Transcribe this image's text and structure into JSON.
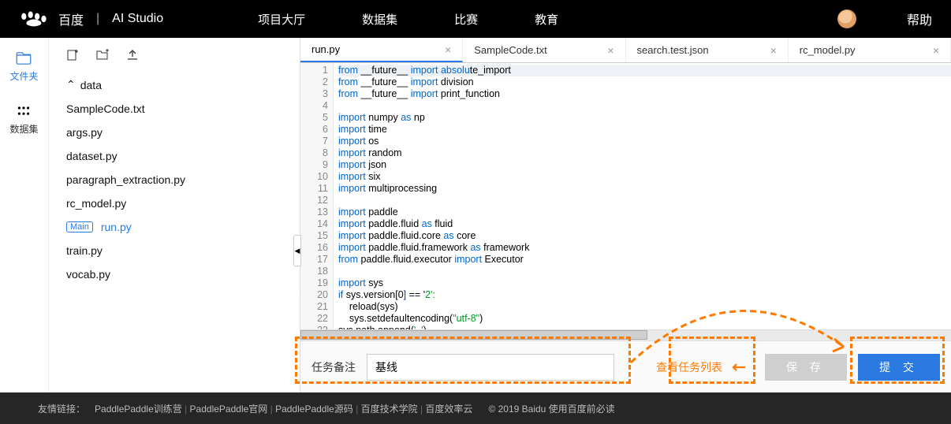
{
  "header": {
    "brand_left": "百度",
    "brand_right": "AI Studio",
    "nav": [
      "项目大厅",
      "数据集",
      "比赛",
      "教育"
    ],
    "help": "帮助"
  },
  "siderail": {
    "files_label": "文件夹",
    "dataset_label": "数据集"
  },
  "filetree": {
    "folder": "data",
    "files": [
      "SampleCode.txt",
      "args.py",
      "dataset.py",
      "paragraph_extraction.py",
      "rc_model.py",
      "run.py",
      "train.py",
      "vocab.py"
    ],
    "main_tag": "Main",
    "selected": "run.py"
  },
  "tabs": [
    {
      "name": "run.py",
      "active": true
    },
    {
      "name": "SampleCode.txt",
      "active": false
    },
    {
      "name": "search.test.json",
      "active": false
    },
    {
      "name": "rc_model.py",
      "active": false
    }
  ],
  "code": {
    "lines": [
      {
        "t": "from __future__ import absolute_import",
        "hl": [
          [
            0,
            4,
            "kw"
          ],
          [
            16,
            6,
            "kw"
          ],
          [
            23,
            6,
            "kw"
          ]
        ]
      },
      {
        "t": "from __future__ import division",
        "hl": [
          [
            0,
            4,
            "kw"
          ],
          [
            16,
            6,
            "kw"
          ]
        ]
      },
      {
        "t": "from __future__ import print_function",
        "hl": [
          [
            0,
            4,
            "kw"
          ],
          [
            16,
            6,
            "kw"
          ]
        ]
      },
      {
        "t": ""
      },
      {
        "t": "import numpy as np",
        "hl": [
          [
            0,
            6,
            "kw"
          ],
          [
            13,
            2,
            "kw"
          ]
        ]
      },
      {
        "t": "import time",
        "hl": [
          [
            0,
            6,
            "kw"
          ]
        ]
      },
      {
        "t": "import os",
        "hl": [
          [
            0,
            6,
            "kw"
          ]
        ]
      },
      {
        "t": "import random",
        "hl": [
          [
            0,
            6,
            "kw"
          ]
        ]
      },
      {
        "t": "import json",
        "hl": [
          [
            0,
            6,
            "kw"
          ]
        ]
      },
      {
        "t": "import six",
        "hl": [
          [
            0,
            6,
            "kw"
          ]
        ]
      },
      {
        "t": "import multiprocessing",
        "hl": [
          [
            0,
            6,
            "kw"
          ]
        ]
      },
      {
        "t": ""
      },
      {
        "t": "import paddle",
        "hl": [
          [
            0,
            6,
            "kw"
          ]
        ]
      },
      {
        "t": "import paddle.fluid as fluid",
        "hl": [
          [
            0,
            6,
            "kw"
          ],
          [
            20,
            2,
            "kw"
          ]
        ]
      },
      {
        "t": "import paddle.fluid.core as core",
        "hl": [
          [
            0,
            6,
            "kw"
          ],
          [
            25,
            2,
            "kw"
          ]
        ]
      },
      {
        "t": "import paddle.fluid.framework as framework",
        "hl": [
          [
            0,
            6,
            "kw"
          ],
          [
            30,
            2,
            "kw"
          ]
        ]
      },
      {
        "t": "from paddle.fluid.executor import Executor",
        "hl": [
          [
            0,
            4,
            "kw"
          ],
          [
            27,
            6,
            "kw"
          ]
        ]
      },
      {
        "t": ""
      },
      {
        "t": "import sys",
        "hl": [
          [
            0,
            6,
            "kw"
          ]
        ]
      },
      {
        "t": "if sys.version[0] == '2':",
        "fold": true,
        "hl": [
          [
            0,
            2,
            "kw"
          ],
          [
            16,
            1,
            "num"
          ],
          [
            22,
            3,
            "lit"
          ]
        ]
      },
      {
        "t": "    reload(sys)"
      },
      {
        "t": "    sys.setdefaultencoding(\"utf-8\")",
        "hl": [
          [
            27,
            7,
            "lit"
          ]
        ]
      },
      {
        "t": "sys.path.append('..')",
        "hl": [
          [
            16,
            4,
            "lit"
          ]
        ]
      },
      {
        "t": ""
      }
    ]
  },
  "bottom": {
    "label": "任务备注",
    "input_value": "基线",
    "view_tasks": "查看任务列表",
    "save": "保 存",
    "submit": "提 交"
  },
  "footer": {
    "lead": "友情链接：",
    "links": [
      "PaddlePaddle训练营",
      "PaddlePaddle官网",
      "PaddlePaddle源码",
      "百度技术学院",
      "百度效率云"
    ],
    "copyright": "© 2019 Baidu 使用百度前必读"
  }
}
